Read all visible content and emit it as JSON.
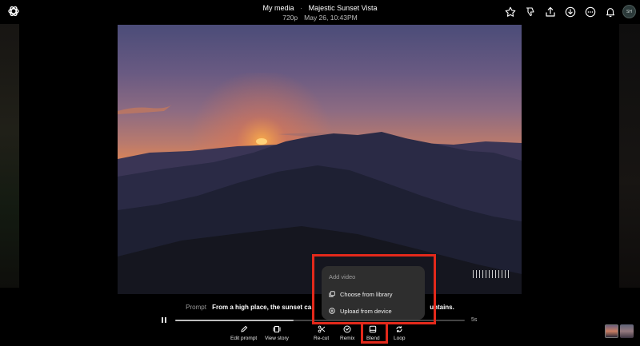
{
  "header": {
    "breadcrumb_root": "My media",
    "breadcrumb_sep": "·",
    "title": "Majestic Sunset Vista",
    "resolution": "720p",
    "date": "May 26, 10:43PM"
  },
  "top_actions": {
    "icons": [
      "star-icon",
      "thumbs-down-icon",
      "share-icon",
      "download-icon",
      "more-icon",
      "bell-icon"
    ],
    "avatar_initials": "SH"
  },
  "prompt": {
    "label": "Prompt",
    "text_before": "From a high place, the sunset ca",
    "text_after": "untains."
  },
  "playback": {
    "duration": "5s",
    "progress": 0.41
  },
  "popup": {
    "header": "Add video",
    "items": [
      {
        "label": "Choose from library",
        "icon": "library-icon"
      },
      {
        "label": "Upload from device",
        "icon": "upload-plus-icon"
      }
    ]
  },
  "toolbar": {
    "edit_prompt": "Edit prompt",
    "view_story": "View story",
    "recut": "Re-cut",
    "remix": "Remix",
    "blend": "Blend",
    "loop": "Loop"
  },
  "colors": {
    "highlight": "#e3291b",
    "popup_bg": "#2e2e2e"
  }
}
